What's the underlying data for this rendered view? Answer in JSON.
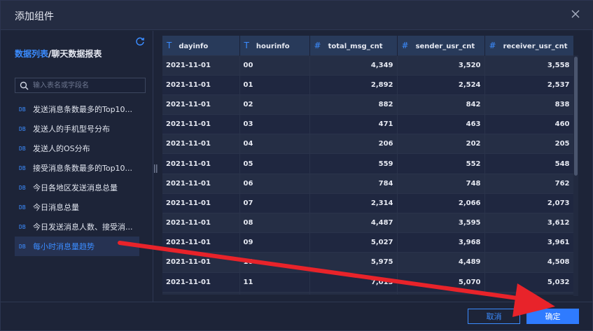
{
  "dialog": {
    "title": "添加组件",
    "close_icon": "close-icon"
  },
  "sidebar": {
    "breadcrumb_link": "数据列表",
    "breadcrumb_sep": "/",
    "breadcrumb_current": "聊天数据报表",
    "refresh_icon": "refresh-icon",
    "search_placeholder": "输入表名或字段名",
    "db_badge": "DB",
    "items": [
      {
        "label": "发送消息条数最多的Top10..."
      },
      {
        "label": "发送人的手机型号分布"
      },
      {
        "label": "发送人的OS分布"
      },
      {
        "label": "接受消息条数最多的Top10..."
      },
      {
        "label": "今日各地区发送消息总量"
      },
      {
        "label": "今日消息总量"
      },
      {
        "label": "今日发送消息人数、接受消..."
      },
      {
        "label": "每小时消息量趋势"
      }
    ],
    "active_index": 7
  },
  "table": {
    "columns": [
      {
        "type_icon": "T",
        "name": "dayinfo"
      },
      {
        "type_icon": "T",
        "name": "hourinfo"
      },
      {
        "type_icon": "#",
        "name": "total_msg_cnt"
      },
      {
        "type_icon": "#",
        "name": "sender_usr_cnt"
      },
      {
        "type_icon": "#",
        "name": "receiver_usr_cnt"
      }
    ],
    "rows": [
      [
        "2021-11-01",
        "00",
        "4,349",
        "3,520",
        "3,558"
      ],
      [
        "2021-11-01",
        "01",
        "2,892",
        "2,524",
        "2,537"
      ],
      [
        "2021-11-01",
        "02",
        "882",
        "842",
        "838"
      ],
      [
        "2021-11-01",
        "03",
        "471",
        "463",
        "460"
      ],
      [
        "2021-11-01",
        "04",
        "206",
        "202",
        "205"
      ],
      [
        "2021-11-01",
        "05",
        "559",
        "552",
        "548"
      ],
      [
        "2021-11-01",
        "06",
        "784",
        "748",
        "762"
      ],
      [
        "2021-11-01",
        "07",
        "2,314",
        "2,066",
        "2,073"
      ],
      [
        "2021-11-01",
        "08",
        "4,487",
        "3,595",
        "3,612"
      ],
      [
        "2021-11-01",
        "09",
        "5,027",
        "3,968",
        "3,961"
      ],
      [
        "2021-11-01",
        "10",
        "5,975",
        "4,489",
        "4,508"
      ],
      [
        "2021-11-01",
        "11",
        "7,013",
        "5,070",
        "5,032"
      ],
      [
        "2021-11-01",
        "12",
        "",
        "",
        ""
      ]
    ]
  },
  "footer": {
    "cancel_label": "取消",
    "ok_label": "确定"
  },
  "colors": {
    "accent": "#3b8cff",
    "annotation_arrow": "#e8232a"
  }
}
